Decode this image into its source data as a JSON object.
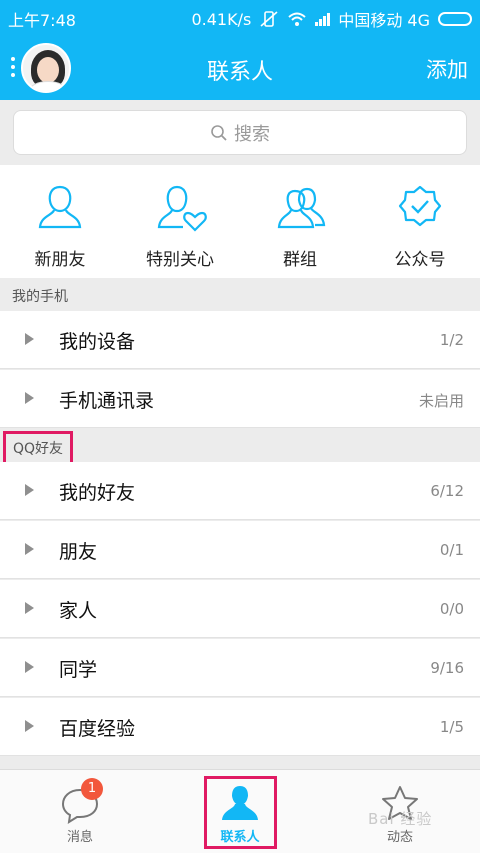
{
  "status": {
    "time": "上午7:48",
    "speed": "0.41K/s",
    "carrier": "中国移动 4G"
  },
  "header": {
    "title": "联系人",
    "add_label": "添加"
  },
  "search": {
    "placeholder": "搜索"
  },
  "quick": [
    {
      "label": "新朋友",
      "icon": "new-friend-icon"
    },
    {
      "label": "特别关心",
      "icon": "special-care-icon"
    },
    {
      "label": "群组",
      "icon": "group-icon"
    },
    {
      "label": "公众号",
      "icon": "official-account-icon"
    }
  ],
  "sections": {
    "phone": "我的手机",
    "qq": "QQ好友"
  },
  "phone_rows": [
    {
      "name": "我的设备",
      "count": "1/2"
    },
    {
      "name": "手机通讯录",
      "count": "未启用"
    }
  ],
  "friend_rows": [
    {
      "name": "我的好友",
      "count": "6/12"
    },
    {
      "name": "朋友",
      "count": "0/1"
    },
    {
      "name": "家人",
      "count": "0/0"
    },
    {
      "name": "同学",
      "count": "9/16"
    },
    {
      "name": "百度经验",
      "count": "1/5"
    }
  ],
  "tabs": {
    "messages": {
      "label": "消息",
      "badge": "1"
    },
    "contacts": {
      "label": "联系人"
    },
    "dynamic": {
      "label": "动态"
    }
  },
  "watermark": "Bai 经验",
  "colors": {
    "accent": "#12b7f5",
    "highlight": "#e01a63",
    "badge": "#f2573c"
  }
}
